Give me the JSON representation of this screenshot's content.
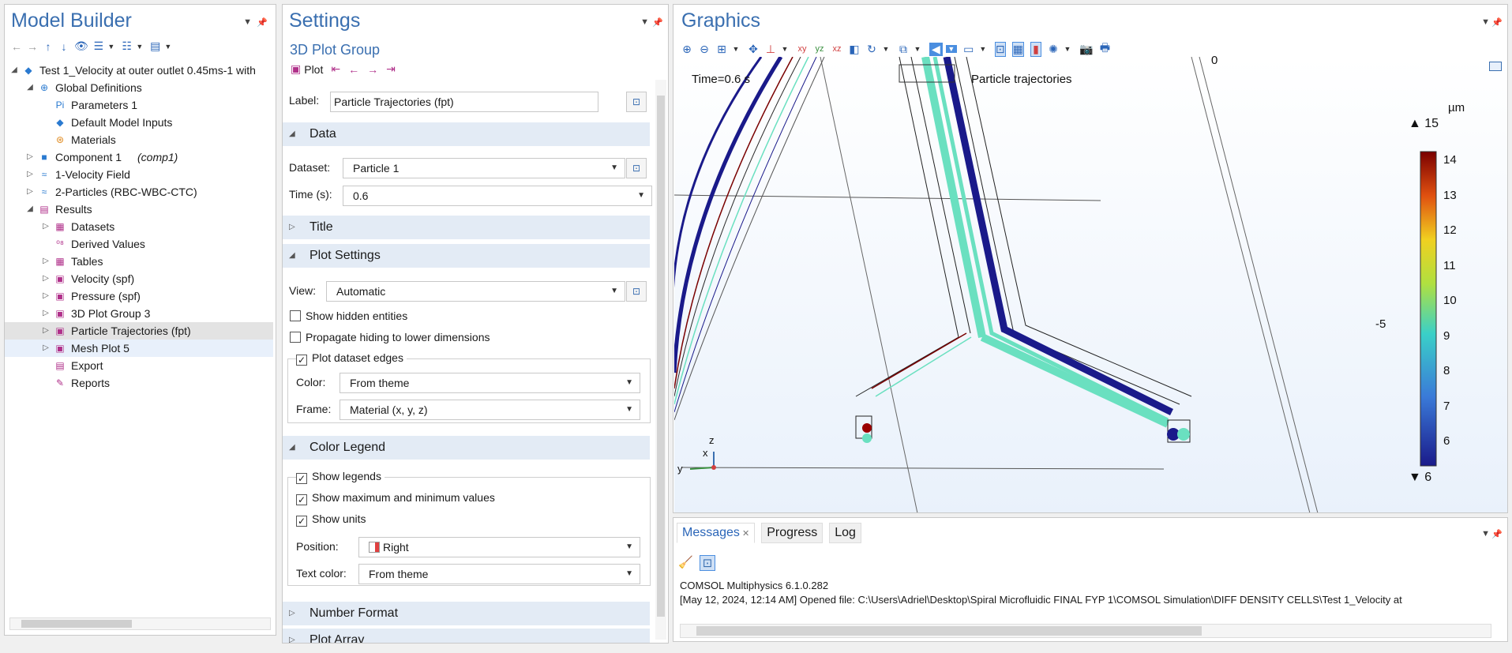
{
  "model_builder": {
    "title": "Model Builder",
    "tree": [
      {
        "label": "Test 1_Velocity at outer outlet 0.45ms-1 with",
        "depth": 0,
        "arrow": "◢",
        "icon": "◆",
        "icon_color": "#2a7ad0"
      },
      {
        "label": "Global Definitions",
        "depth": 1,
        "arrow": "◢",
        "icon": "⊕",
        "icon_color": "#2a7ad0"
      },
      {
        "label": "Parameters 1",
        "depth": 2,
        "arrow": "",
        "icon": "Pi",
        "icon_color": "#2a7ad0"
      },
      {
        "label": "Default Model Inputs",
        "depth": 2,
        "arrow": "",
        "icon": "◆",
        "icon_color": "#2a7ad0"
      },
      {
        "label": "Materials",
        "depth": 2,
        "arrow": "",
        "icon": "⊛",
        "icon_color": "#e08a1e"
      },
      {
        "label": "Component 1",
        "suffix": "(comp1)",
        "depth": 1,
        "arrow": "▷",
        "icon": "■",
        "icon_color": "#2a7ad0"
      },
      {
        "label": "1-Velocity Field",
        "depth": 1,
        "arrow": "▷",
        "icon": "≈",
        "icon_color": "#2a7ad0"
      },
      {
        "label": "2-Particles (RBC-WBC-CTC)",
        "depth": 1,
        "arrow": "▷",
        "icon": "≈",
        "icon_color": "#2a7ad0"
      },
      {
        "label": "Results",
        "depth": 1,
        "arrow": "◢",
        "icon": "▤",
        "icon_color": "#b0308a"
      },
      {
        "label": "Datasets",
        "depth": 2,
        "arrow": "▷",
        "icon": "▦",
        "icon_color": "#b0308a"
      },
      {
        "label": "Derived Values",
        "depth": 2,
        "arrow": "",
        "icon": "⁰⁸",
        "icon_color": "#b0308a"
      },
      {
        "label": "Tables",
        "depth": 2,
        "arrow": "▷",
        "icon": "▦",
        "icon_color": "#b0308a"
      },
      {
        "label": "Velocity (spf)",
        "depth": 2,
        "arrow": "▷",
        "icon": "▣",
        "icon_color": "#b0308a"
      },
      {
        "label": "Pressure (spf)",
        "depth": 2,
        "arrow": "▷",
        "icon": "▣",
        "icon_color": "#b0308a"
      },
      {
        "label": "3D Plot Group 3",
        "depth": 2,
        "arrow": "▷",
        "icon": "▣",
        "icon_color": "#b0308a"
      },
      {
        "label": "Particle Trajectories (fpt)",
        "depth": 2,
        "arrow": "▷",
        "icon": "▣",
        "icon_color": "#b0308a",
        "selected": true
      },
      {
        "label": "Mesh Plot 5",
        "depth": 2,
        "arrow": "▷",
        "icon": "▣",
        "icon_color": "#b0308a",
        "highlight": true
      },
      {
        "label": "Export",
        "depth": 2,
        "arrow": "",
        "icon": "▤",
        "icon_color": "#b0308a"
      },
      {
        "label": "Reports",
        "depth": 2,
        "arrow": "",
        "icon": "✎",
        "icon_color": "#b0308a"
      }
    ]
  },
  "settings": {
    "title": "Settings",
    "subtitle": "3D Plot Group",
    "plot_label": "Plot",
    "label_caption": "Label:",
    "label_value": "Particle Trajectories (fpt)",
    "sections": {
      "data": "Data",
      "title": "Title",
      "plot_settings": "Plot Settings",
      "color_legend": "Color Legend",
      "number_format": "Number Format",
      "plot_array": "Plot Array"
    },
    "dataset_caption": "Dataset:",
    "dataset_value": "Particle 1",
    "time_caption": "Time (s):",
    "time_value": "0.6",
    "view_caption": "View:",
    "view_value": "Automatic",
    "show_hidden": "Show hidden entities",
    "propagate_hiding": "Propagate hiding to lower dimensions",
    "plot_dataset_edges": "Plot dataset edges",
    "color_caption": "Color:",
    "color_value": "From theme",
    "frame_caption": "Frame:",
    "frame_value": "Material  (x, y, z)",
    "show_legends": "Show legends",
    "show_maxmin": "Show maximum and minimum values",
    "show_units": "Show units",
    "position_caption": "Position:",
    "position_value": "Right",
    "text_color_caption": "Text color:",
    "text_color_value": "From theme"
  },
  "graphics": {
    "title": "Graphics",
    "time_text": "Time=0.6 s",
    "plot_title": "Particle trajectories",
    "axis_zero": "0",
    "side_label": "-5",
    "legend": {
      "unit": "µm",
      "max_label": "▲ 15",
      "min_label": "▼ 6",
      "ticks": [
        "14",
        "13",
        "12",
        "11",
        "10",
        "9",
        "8",
        "7",
        "6"
      ],
      "color_max": "#7a0000",
      "color_min": "#1a1a8a"
    },
    "axes": {
      "x": "x",
      "y": "y",
      "z": "z"
    }
  },
  "messages": {
    "tabs": [
      "Messages",
      "Progress",
      "Log"
    ],
    "lines": [
      "COMSOL Multiphysics 6.1.0.282",
      "[May 12, 2024, 12:14 AM] Opened file: C:\\Users\\Adriel\\Desktop\\Spiral Microfluidic FINAL FYP 1\\COMSOL Simulation\\DIFF DENSITY CELLS\\Test 1_Velocity at"
    ]
  }
}
